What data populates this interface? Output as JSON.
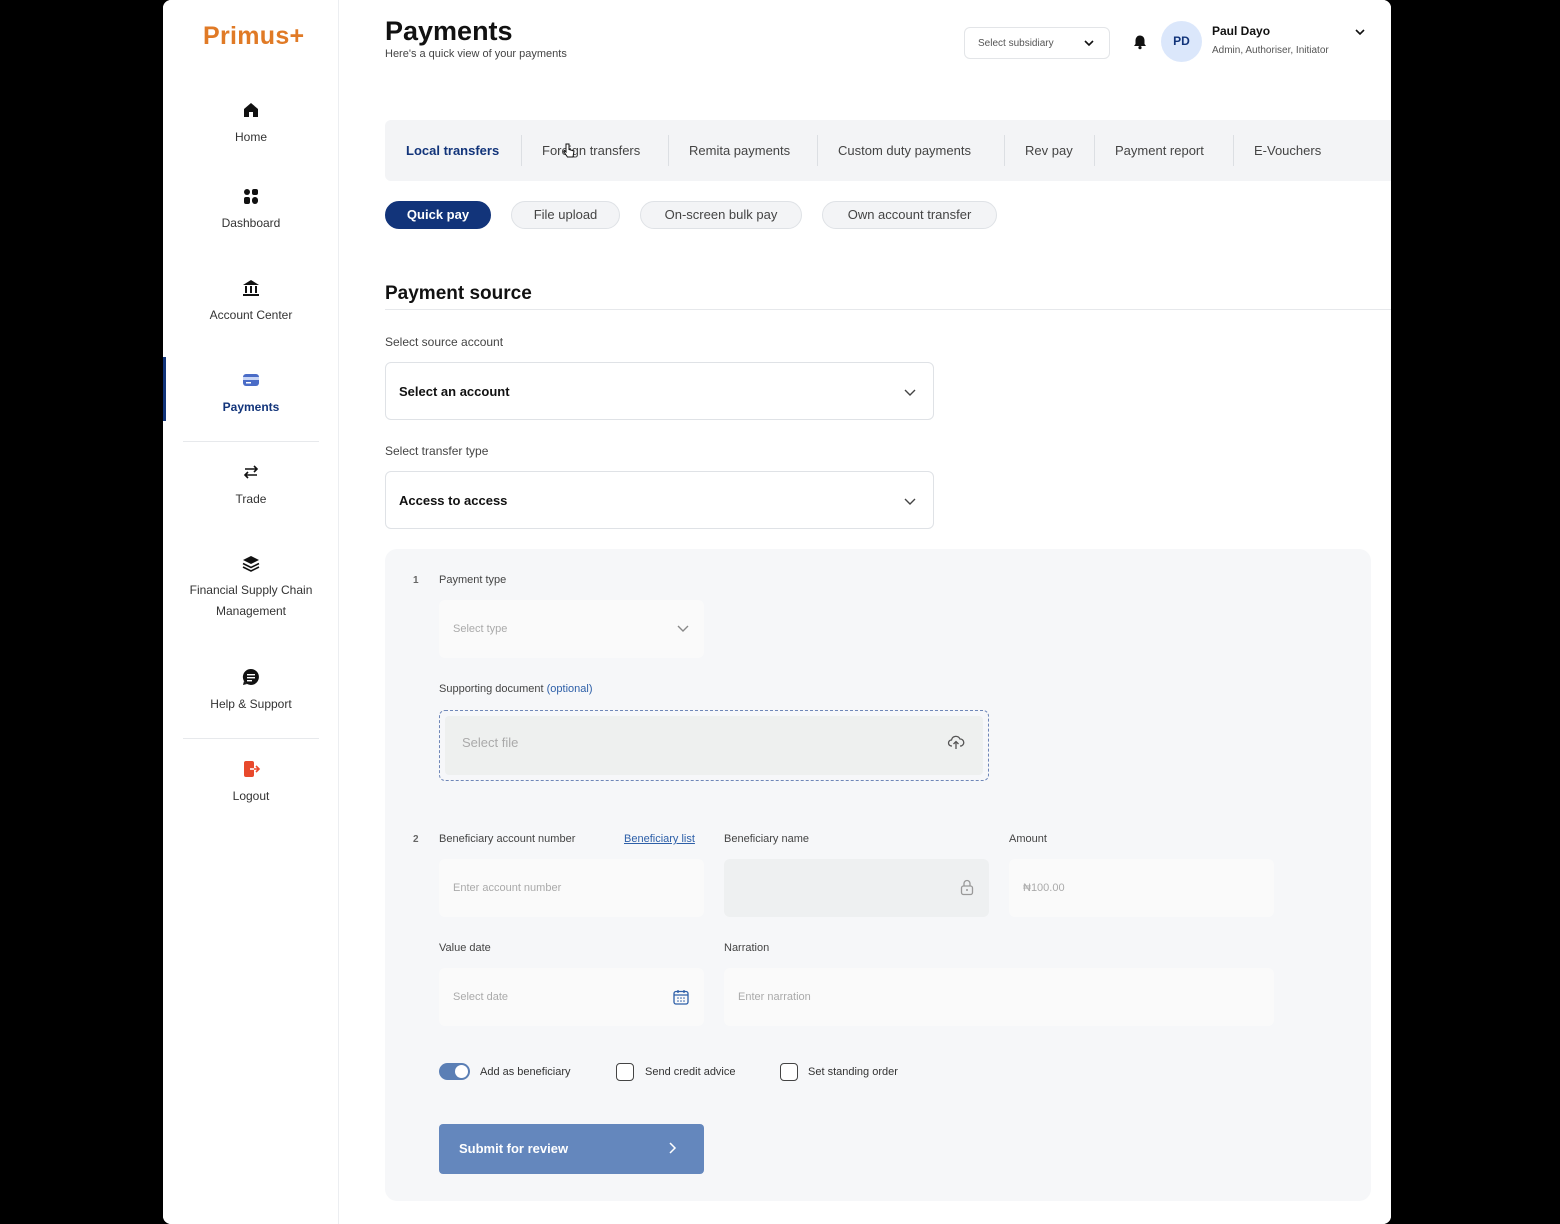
{
  "app": {
    "logo": "Primus+"
  },
  "sidebar": {
    "items": [
      {
        "label": "Home",
        "icon": "home-icon"
      },
      {
        "label": "Dashboard",
        "icon": "dashboard-icon"
      },
      {
        "label": "Account Center",
        "icon": "bank-icon"
      },
      {
        "label": "Payments",
        "icon": "card-icon",
        "active": true
      },
      {
        "label": "Trade",
        "icon": "swap-arrows-icon"
      },
      {
        "label": "Financial Supply Chain Management",
        "icon": "layers-icon"
      },
      {
        "label": "Help & Support",
        "icon": "chat-icon"
      },
      {
        "label": "Logout",
        "icon": "logout-icon"
      }
    ]
  },
  "header": {
    "title": "Payments",
    "subtitle": "Here's a quick view of your payments",
    "subsidiary_placeholder": "Select subsidiary",
    "user": {
      "initials": "PD",
      "name": "Paul Dayo",
      "roles": "Admin, Authoriser, Initiator"
    }
  },
  "tabs": [
    {
      "label": "Local transfers",
      "active": true
    },
    {
      "label": "Foreign transfers"
    },
    {
      "label": "Remita payments"
    },
    {
      "label": "Custom duty payments"
    },
    {
      "label": "Rev pay"
    },
    {
      "label": "Payment report"
    },
    {
      "label": "E-Vouchers"
    }
  ],
  "subtabs": [
    {
      "label": "Quick pay",
      "active": true
    },
    {
      "label": "File upload"
    },
    {
      "label": "On-screen bulk pay"
    },
    {
      "label": "Own account transfer"
    }
  ],
  "payment_source": {
    "title": "Payment source",
    "source_label": "Select source account",
    "source_value": "Select an account",
    "transfer_type_label": "Select transfer type",
    "transfer_type_value": "Access to access"
  },
  "form": {
    "step1": "1",
    "payment_type_label": "Payment type",
    "payment_type_placeholder": "Select type",
    "supporting_doc_label": "Supporting document",
    "optional": "(optional)",
    "select_file": "Select file",
    "step2": "2",
    "beneficiary_account_label": "Beneficiary account number",
    "beneficiary_list_link": "Beneficiary list",
    "beneficiary_account_placeholder": "Enter account number",
    "beneficiary_name_label": "Beneficiary name",
    "amount_label": "Amount",
    "amount_placeholder": "₦100.00",
    "value_date_label": "Value date",
    "value_date_placeholder": "Select date",
    "narration_label": "Narration",
    "narration_placeholder": "Enter narration",
    "add_beneficiary": "Add as beneficiary",
    "add_beneficiary_on": true,
    "send_credit_advice": "Send credit advice",
    "send_credit_advice_checked": false,
    "standing_order": "Set standing order",
    "standing_order_checked": false,
    "submit": "Submit for review"
  },
  "colors": {
    "brand": "#e07a26",
    "primary": "#12347a",
    "submit": "#6487bd"
  }
}
